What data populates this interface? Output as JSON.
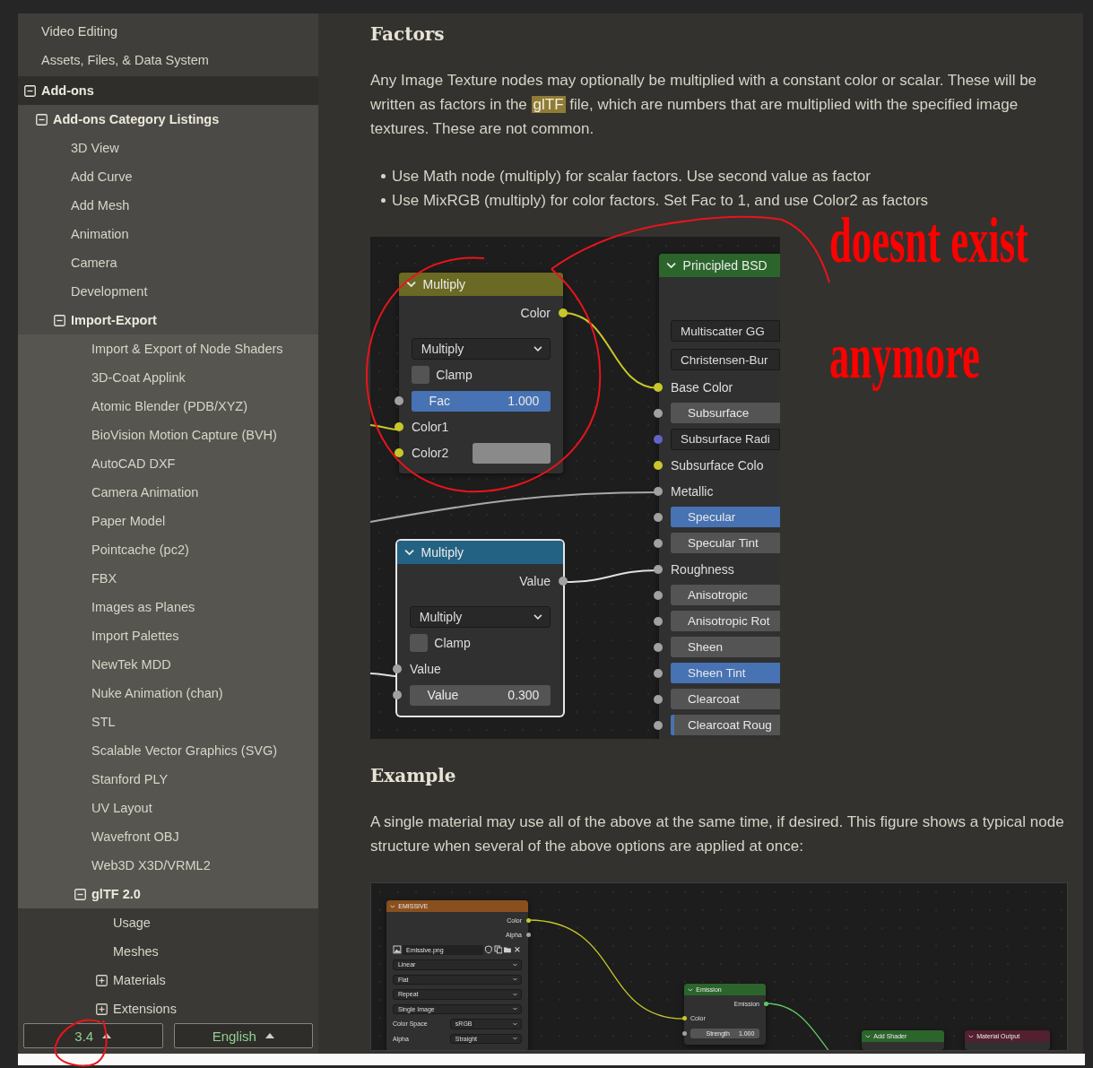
{
  "sidebar": {
    "tree": [
      {
        "label": "Video Editing"
      },
      {
        "label": "Assets, Files, & Data System"
      },
      {
        "label": "Add-ons",
        "expanded": true,
        "children": [
          {
            "label": "Add-ons Category Listings",
            "expanded": true,
            "children": [
              {
                "label": "3D View"
              },
              {
                "label": "Add Curve"
              },
              {
                "label": "Add Mesh"
              },
              {
                "label": "Animation"
              },
              {
                "label": "Camera"
              },
              {
                "label": "Development"
              },
              {
                "label": "Import-Export",
                "expanded": true,
                "children": [
                  {
                    "label": "Import & Export of Node Shaders"
                  },
                  {
                    "label": "3D-Coat Applink"
                  },
                  {
                    "label": "Atomic Blender (PDB/XYZ)"
                  },
                  {
                    "label": "BioVision Motion Capture (BVH)"
                  },
                  {
                    "label": "AutoCAD DXF"
                  },
                  {
                    "label": "Camera Animation"
                  },
                  {
                    "label": "Paper Model"
                  },
                  {
                    "label": "Pointcache (pc2)"
                  },
                  {
                    "label": "FBX"
                  },
                  {
                    "label": "Images as Planes"
                  },
                  {
                    "label": "Import Palettes"
                  },
                  {
                    "label": "NewTek MDD"
                  },
                  {
                    "label": "Nuke Animation (chan)"
                  },
                  {
                    "label": "STL"
                  },
                  {
                    "label": "Scalable Vector Graphics (SVG)"
                  },
                  {
                    "label": "Stanford PLY"
                  },
                  {
                    "label": "UV Layout"
                  },
                  {
                    "label": "Wavefront OBJ"
                  },
                  {
                    "label": "Web3D X3D/VRML2"
                  },
                  {
                    "label": "glTF 2.0",
                    "expanded": true,
                    "children": [
                      {
                        "label": "Usage"
                      },
                      {
                        "label": "Meshes"
                      },
                      {
                        "label": "Materials",
                        "expanded": false
                      },
                      {
                        "label": "Extensions",
                        "expanded": false
                      }
                    ]
                  }
                ]
              }
            ]
          }
        ]
      }
    ],
    "footer": {
      "version_button": "3.4",
      "language_button": "English"
    }
  },
  "content": {
    "factors_heading": "Factors",
    "factors_paragraph": [
      {
        "text": "Any Image Texture nodes may optionally be multiplied with a constant color or scalar. These will be written as factors in the ",
        "highlighted": false
      },
      {
        "text": "glTF",
        "highlighted": true
      },
      {
        "text": " file, which are numbers that are multiplied with the specified image textures. These are not common.",
        "highlighted": false
      }
    ],
    "bullets": [
      "Use Math node (multiply) for scalar factors. Use second value as factor",
      "Use MixRGB (multiply) for color factors. Set Fac to 1, and use Color2 as factors"
    ],
    "figure_1": {
      "nodes": [
        {
          "kind": "color",
          "title": "Multiply",
          "selected": false,
          "rows": [
            {
              "kind": "output",
              "label": "Color",
              "socket": {
                "color": "#c7c729"
              }
            },
            {
              "kind": "dropdown",
              "value": "Multiply"
            },
            {
              "kind": "checkbox",
              "label": "Clamp",
              "checked": false
            },
            {
              "kind": "slider",
              "label": "Fac",
              "value": "1.000",
              "socket": {
                "color": "#a1a1a1"
              },
              "level": 1
            },
            {
              "kind": "input",
              "label": "Color1",
              "socket": {
                "color": "#c7c729"
              }
            },
            {
              "kind": "color_input",
              "label": "Color2",
              "socket": {
                "color": "#c7c729"
              },
              "color": "#8a8a8a"
            }
          ]
        },
        {
          "kind": "converter",
          "title": "Multiply",
          "selected": true,
          "rows": [
            {
              "kind": "output",
              "label": "Value",
              "socket": {
                "color": "#a1a1a1"
              }
            },
            {
              "kind": "dropdown",
              "value": "Multiply"
            },
            {
              "kind": "checkbox",
              "label": "Clamp",
              "checked": false
            },
            {
              "kind": "input",
              "label": "Value",
              "socket": {
                "color": "#a1a1a1"
              }
            },
            {
              "kind": "value_field",
              "label": "Value",
              "value": "0.300",
              "socket": {
                "color": "#a1a1a1"
              }
            }
          ]
        },
        {
          "kind": "shader",
          "title": "Principled BSD",
          "selected": false,
          "rows": [
            {
              "kind": "menu_field",
              "value": "Multiscatter GG"
            },
            {
              "kind": "menu_field",
              "value": "Christensen-Bur"
            },
            {
              "kind": "input",
              "label": "Base Color",
              "socket": {
                "color": "#c7c729"
              }
            },
            {
              "kind": "slider",
              "label": "Subsurface",
              "socket": {
                "color": "#a1a1a1"
              }
            },
            {
              "kind": "field",
              "label": "Subsurface Radi",
              "socket": {
                "color": "#6363c7"
              }
            },
            {
              "kind": "input",
              "label": "Subsurface Colo",
              "socket": {
                "color": "#c7c729"
              }
            },
            {
              "kind": "input",
              "label": "Metallic",
              "socket": {
                "color": "#a1a1a1"
              }
            },
            {
              "kind": "slider",
              "label": "Specular",
              "socket": {
                "color": "#a1a1a1"
              },
              "level": 1
            },
            {
              "kind": "slider",
              "label": "Specular Tint",
              "socket": {
                "color": "#a1a1a1"
              }
            },
            {
              "kind": "input",
              "label": "Roughness",
              "socket": {
                "color": "#a1a1a1"
              }
            },
            {
              "kind": "slider",
              "label": "Anisotropic",
              "socket": {
                "color": "#a1a1a1"
              }
            },
            {
              "kind": "slider",
              "label": "Anisotropic Rot",
              "socket": {
                "color": "#a1a1a1"
              }
            },
            {
              "kind": "slider",
              "label": "Sheen",
              "socket": {
                "color": "#a1a1a1"
              }
            },
            {
              "kind": "slider",
              "label": "Sheen Tint",
              "socket": {
                "color": "#a1a1a1"
              },
              "level": 1
            },
            {
              "kind": "slider",
              "label": "Clearcoat",
              "socket": {
                "color": "#a1a1a1"
              }
            },
            {
              "kind": "slider",
              "label": "Clearcoat Roug",
              "socket": {
                "color": "#a1a1a1"
              },
              "level": 0.03
            }
          ]
        }
      ]
    },
    "example_heading": "Example",
    "example_paragraph": "A single material may use all of the above at the same time, if desired. This figure shows a typical node structure when several of the above options are applied at once:",
    "figure_2": {
      "nodes": [
        {
          "kind": "texture",
          "title": "EMISSIVE",
          "selected": false,
          "rows": [
            {
              "kind": "output",
              "label": "Color",
              "socket": {
                "color": "#c7c729"
              }
            },
            {
              "kind": "output",
              "label": "Alpha",
              "socket": {
                "color": "#a1a1a1"
              }
            },
            {
              "kind": "image_selector",
              "value": "Emissive.png"
            },
            {
              "kind": "dropdown",
              "value": "Linear"
            },
            {
              "kind": "dropdown",
              "value": "Flat"
            },
            {
              "kind": "dropdown",
              "value": "Repeat"
            },
            {
              "kind": "dropdown",
              "value": "Single Image"
            },
            {
              "kind": "labeled_dropdown",
              "label": "Color Space",
              "value": "sRGB"
            },
            {
              "kind": "labeled_dropdown",
              "label": "Alpha",
              "value": "Straight"
            }
          ]
        },
        {
          "kind": "shader",
          "title": "Emission",
          "selected": false,
          "rows": [
            {
              "kind": "output",
              "label": "Emission",
              "socket": {
                "color": "#63c763"
              }
            },
            {
              "kind": "input",
              "label": "Color",
              "socket": {
                "color": "#c7c729"
              }
            },
            {
              "kind": "value_field",
              "label": "Strength",
              "value": "1.000",
              "socket": {
                "color": "#a1a1a1"
              }
            }
          ]
        },
        {
          "kind": "shader",
          "title": "Add Shader",
          "selected": false
        },
        {
          "kind": "output",
          "title": "Material Output",
          "selected": false
        }
      ]
    }
  },
  "annotations": {
    "notes": [
      "doesnt exist",
      "anymore"
    ]
  }
}
